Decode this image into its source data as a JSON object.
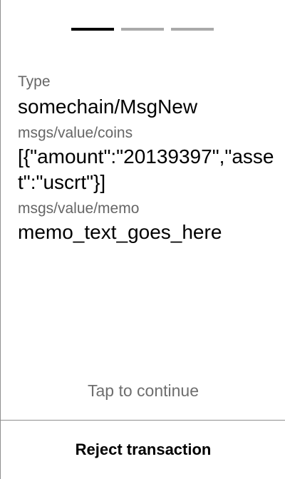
{
  "pager": {
    "current_page": 1,
    "total_pages": 3,
    "active_color": "#000000",
    "inactive_color": "#aaaaaa"
  },
  "fields": [
    {
      "label": "Type",
      "value": "somechain/MsgNew"
    },
    {
      "label": "msgs/value/coins",
      "value": "[{\"amount\":\"20139397\",\"asset\":\"uscrt\"}]"
    },
    {
      "label": "msgs/value/memo",
      "value": "memo_text_goes_here"
    }
  ],
  "tap_hint": "Tap to continue",
  "reject_button": {
    "label": "Reject transaction"
  },
  "divider_color": "#8f8f8f"
}
